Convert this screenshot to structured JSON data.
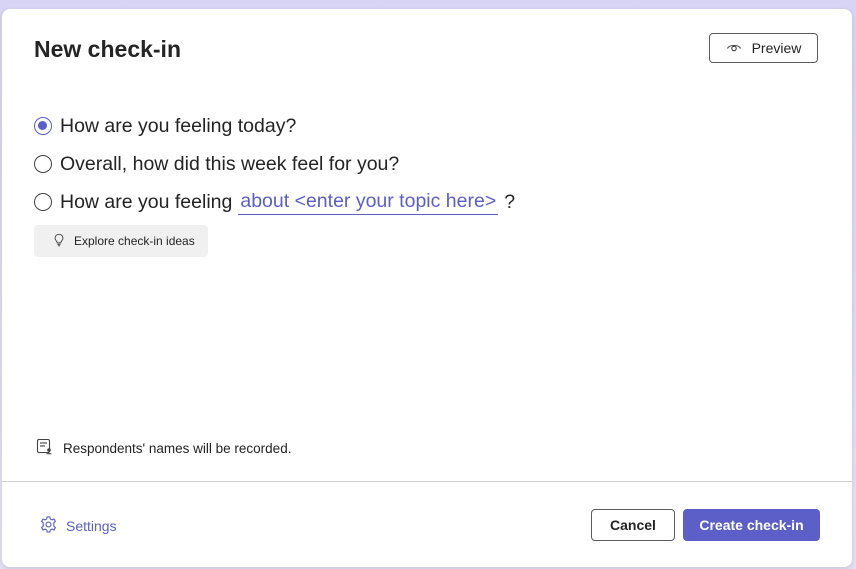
{
  "dialog": {
    "title": "New check-in",
    "preview_label": "Preview"
  },
  "options": [
    {
      "label": "How are you feeling today?",
      "checked": true
    },
    {
      "label": "Overall, how did this week feel for you?",
      "checked": false
    },
    {
      "label_prefix": "How are you feeling",
      "topic_value": "about <enter your topic here>",
      "label_suffix": "?",
      "checked": false
    }
  ],
  "explore": {
    "label": "Explore check-in ideas",
    "icon": "lightbulb-icon"
  },
  "notice": {
    "text": "Respondents' names will be recorded.",
    "icon": "form-person-icon"
  },
  "footer": {
    "settings_label": "Settings",
    "cancel_label": "Cancel",
    "create_label": "Create check-in"
  },
  "colors": {
    "accent": "#5b5fc7",
    "text": "#242424",
    "backdrop": "#d9d6f2"
  }
}
